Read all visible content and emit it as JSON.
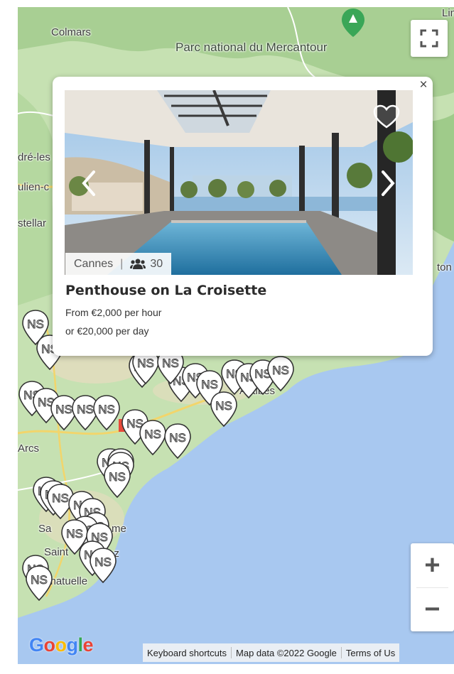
{
  "map": {
    "places": [
      {
        "name": "Colmars"
      },
      {
        "name": "Parc national du Mercantour"
      },
      {
        "name": "Lin"
      },
      {
        "name": "dré-les"
      },
      {
        "name": "ulien-c"
      },
      {
        "name": "stellar"
      },
      {
        "name": "ton"
      },
      {
        "name": "Arcs"
      },
      {
        "name": "Sa"
      },
      {
        "name": "me"
      },
      {
        "name": "Saint"
      },
      {
        "name": "ez"
      },
      {
        "name": "amatuelle"
      },
      {
        "name": "Antibes"
      }
    ],
    "marker_label": "NS",
    "controls": {
      "zoom_in": "+",
      "zoom_out": "−"
    },
    "google_logo": "Google",
    "attribution": {
      "keyboard": "Keyboard shortcuts",
      "map_data": "Map data ©2022 Google",
      "terms": "Terms of Us"
    }
  },
  "popup": {
    "close": "×",
    "location": "Cannes",
    "separator": "|",
    "capacity": "30",
    "title": "Penthouse on La Croisette",
    "price_hour": "From €2,000 per hour",
    "price_day": "or €20,000 per day"
  },
  "colors": {
    "sea": "#a8c8f0",
    "land": "#c9e3b5",
    "marker": "#ffffff",
    "accent": "#4caf50"
  }
}
